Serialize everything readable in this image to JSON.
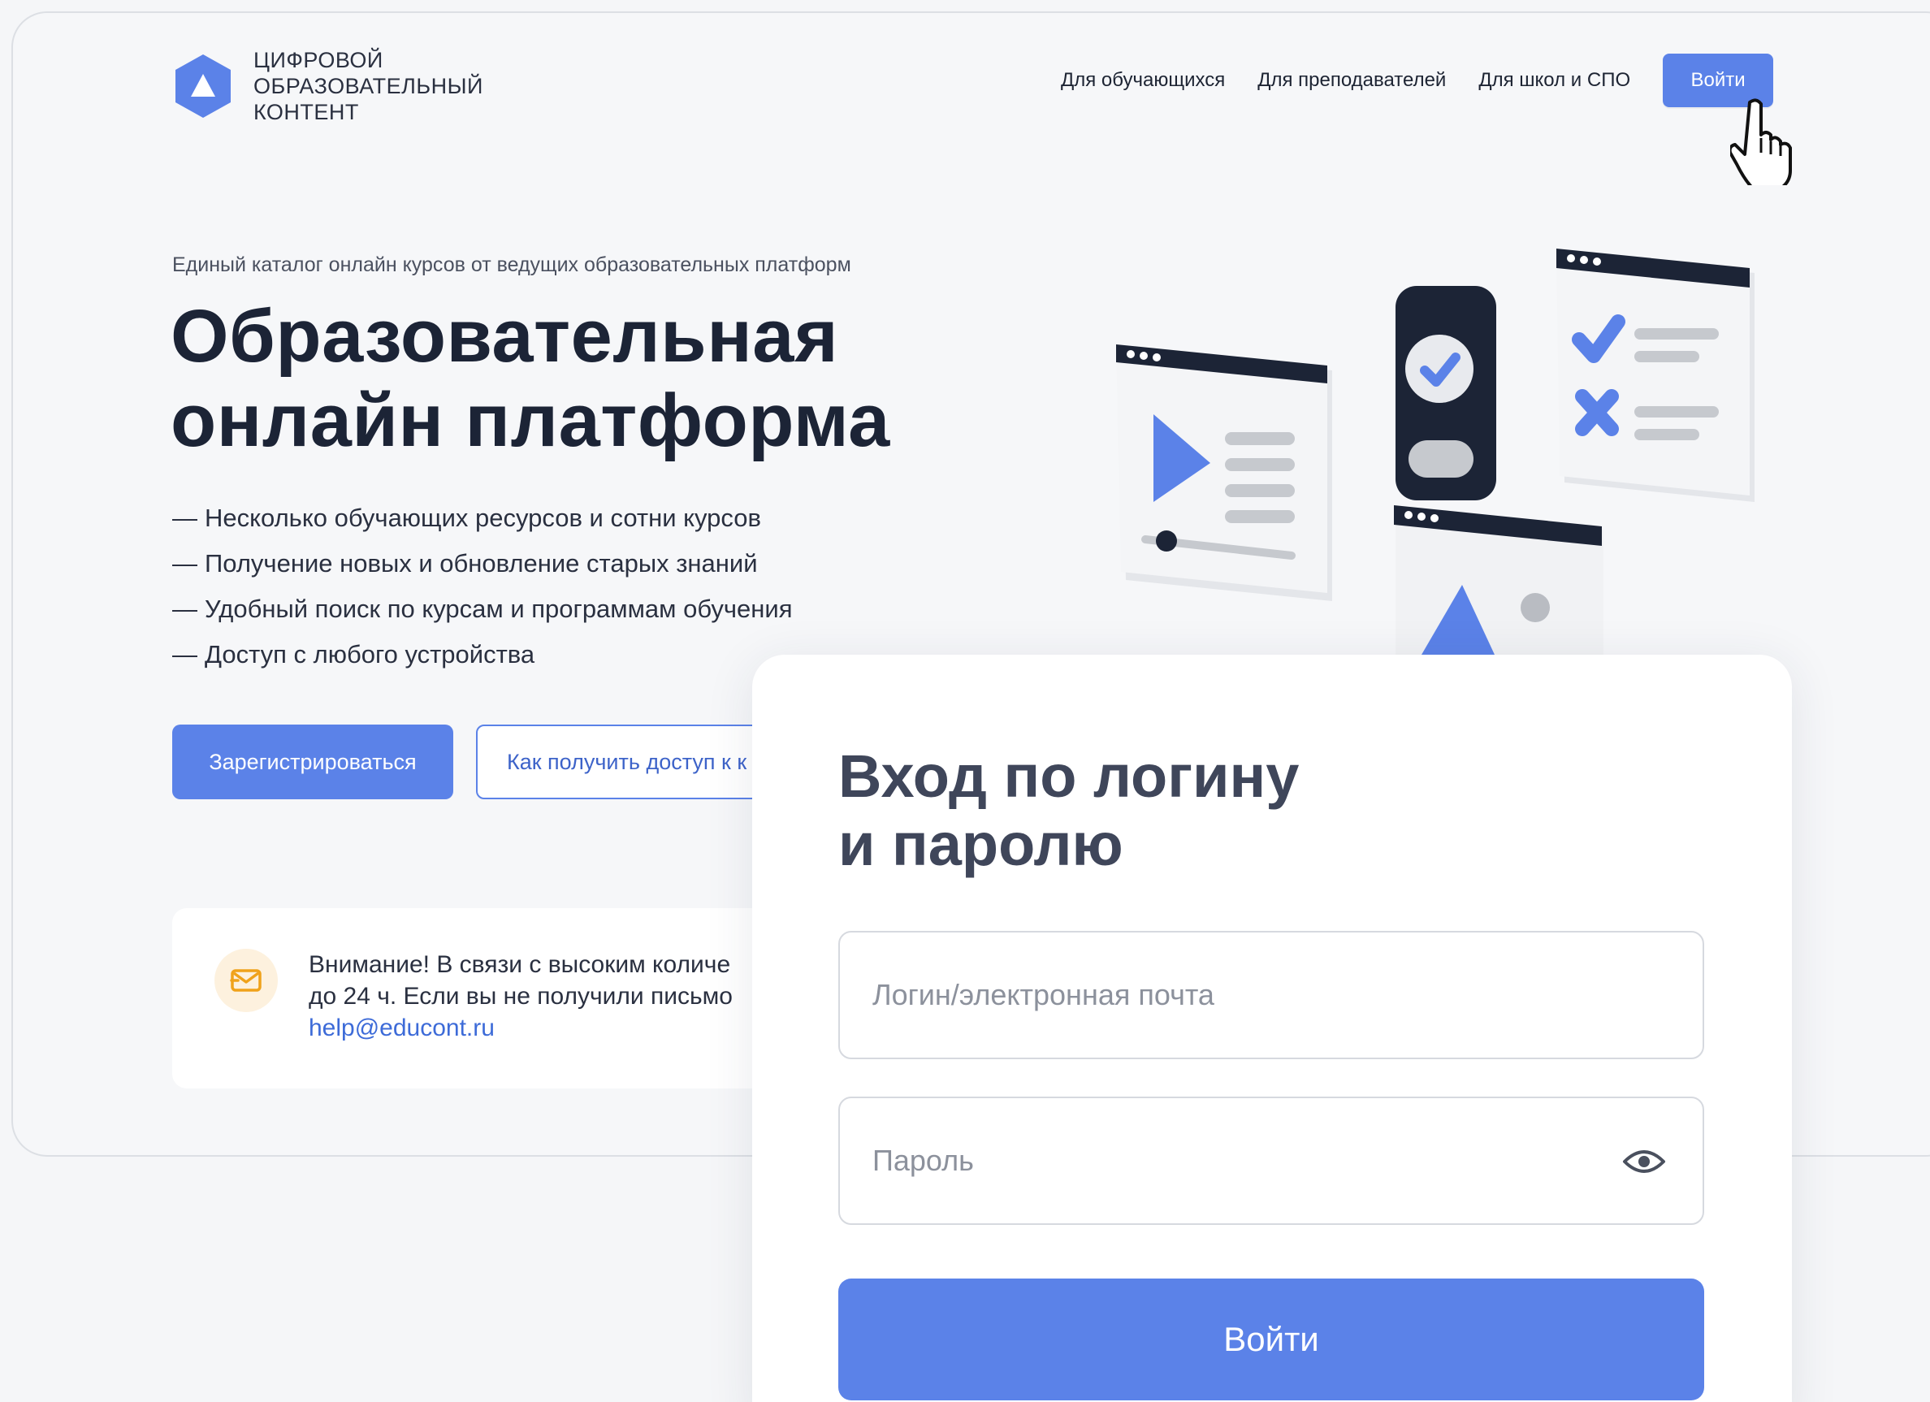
{
  "header": {
    "logo_lines": [
      "ЦИФРОВОЙ",
      "ОБРАЗОВАТЕЛЬНЫЙ",
      "КОНТЕНТ"
    ],
    "nav": [
      {
        "label": "Для обучающихся"
      },
      {
        "label": "Для преподавателей"
      },
      {
        "label": "Для школ и СПО"
      }
    ],
    "login_label": "Войти"
  },
  "hero": {
    "subtitle": "Единый каталог онлайн курсов от ведущих образовательных платформ",
    "title_lines": [
      "Образовательная",
      "онлайн платформа"
    ],
    "features": [
      "Несколько обучающих ресурсов и сотни курсов",
      "Получение новых и обновление старых знаний",
      "Удобный поиск по курсам и программам обучения",
      "Доступ с любого устройства"
    ],
    "dash": "—",
    "register_label": "Зарегистрироваться",
    "access_label": "Как получить доступ к к"
  },
  "notice": {
    "lines": [
      "Внимание! В связи с высоким количе",
      "до 24 ч. Если вы не получили письмо"
    ],
    "email": "help@educont.ru"
  },
  "login_form": {
    "title_lines": [
      "Вход по логину",
      "и паролю"
    ],
    "login_placeholder": "Логин/электронная почта",
    "password_placeholder": "Пароль",
    "submit_label": "Войти"
  },
  "colors": {
    "accent": "#5b82e8",
    "text_dark": "#1c2436",
    "notice_icon": "#f0a21a"
  },
  "icons": {
    "logo": "hexagon-triangle-logo",
    "cursor": "hand-pointer-icon",
    "notice": "mail-icon",
    "eye": "eye-icon"
  }
}
